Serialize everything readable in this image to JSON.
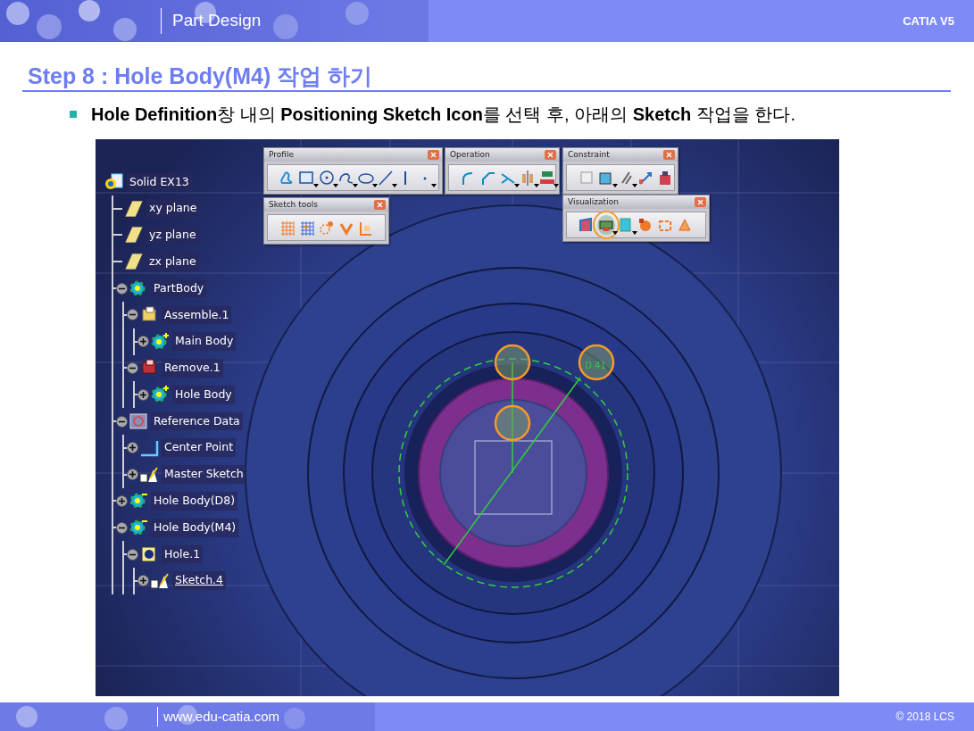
{
  "header": {
    "section": "Part Design",
    "product": "CATIA V5"
  },
  "title": "Step 8 : Hole Body(M4) 작업 하기",
  "instruction": "**Hole Definition**창 내의 **Positioning Sketch Icon**를 선택 후, 아래의 **Sketch** 작업을 한다.",
  "viewport": {
    "tree": [
      {
        "label": "Solid EX13",
        "kind": "part",
        "selected": false,
        "children": [
          {
            "label": "xy plane",
            "kind": "plane",
            "selected": false
          },
          {
            "label": "yz plane",
            "kind": "plane",
            "selected": false
          },
          {
            "label": "zx plane",
            "kind": "plane",
            "selected": false
          },
          {
            "label": "PartBody",
            "kind": "body",
            "selected": false,
            "expanded": true,
            "children": [
              {
                "label": "Assemble.1",
                "kind": "assemble",
                "selected": false,
                "expanded": true,
                "children": [
                  {
                    "label": "Main Body",
                    "kind": "body-plus",
                    "selected": false,
                    "expanded": false
                  }
                ]
              },
              {
                "label": "Remove.1",
                "kind": "remove",
                "selected": false,
                "expanded": true,
                "children": [
                  {
                    "label": "Hole Body",
                    "kind": "body-plus",
                    "selected": false,
                    "expanded": false
                  }
                ]
              }
            ]
          },
          {
            "label": "Reference Data",
            "kind": "reference",
            "selected": false,
            "expanded": true,
            "children": [
              {
                "label": "Center Point",
                "kind": "point",
                "selected": false,
                "expanded": false
              },
              {
                "label": "Master Sketch",
                "kind": "sketch",
                "selected": false,
                "expanded": false
              }
            ]
          },
          {
            "label": "Hole Body(D8)",
            "kind": "body-minus",
            "selected": false,
            "expanded": false
          },
          {
            "label": "Hole Body(M4)",
            "kind": "body-minus",
            "selected": false,
            "expanded": true,
            "children": [
              {
                "label": "Hole.1",
                "kind": "hole",
                "selected": false,
                "expanded": true,
                "children": [
                  {
                    "label": "Sketch.4",
                    "kind": "sketch",
                    "selected": true,
                    "expanded": false
                  }
                ]
              }
            ]
          }
        ]
      }
    ],
    "toolbars": [
      {
        "title": "Profile",
        "tools": [
          {
            "kind": "profile",
            "dropdown": false,
            "highlighted": false
          },
          {
            "kind": "rectangle",
            "dropdown": true,
            "highlighted": false
          },
          {
            "kind": "circle",
            "dropdown": true,
            "highlighted": false
          },
          {
            "kind": "spline",
            "dropdown": true,
            "highlighted": false
          },
          {
            "kind": "ellipse",
            "dropdown": true,
            "highlighted": false
          },
          {
            "kind": "line",
            "dropdown": true,
            "highlighted": false
          },
          {
            "kind": "axis",
            "dropdown": false,
            "highlighted": false
          },
          {
            "kind": "point",
            "dropdown": true,
            "highlighted": false
          }
        ]
      },
      {
        "title": "Operation",
        "tools": [
          {
            "kind": "corner",
            "dropdown": false,
            "highlighted": false
          },
          {
            "kind": "chamfer",
            "dropdown": false,
            "highlighted": false
          },
          {
            "kind": "trim",
            "dropdown": true,
            "highlighted": false
          },
          {
            "kind": "mirror",
            "dropdown": true,
            "highlighted": false
          },
          {
            "kind": "project",
            "dropdown": true,
            "highlighted": false
          }
        ]
      },
      {
        "title": "Constraint",
        "tools": [
          {
            "kind": "constraint-dialog",
            "dropdown": false,
            "highlighted": false
          },
          {
            "kind": "fix",
            "dropdown": true,
            "highlighted": false
          },
          {
            "kind": "contact",
            "dropdown": true,
            "highlighted": false
          },
          {
            "kind": "dimension",
            "dropdown": false,
            "highlighted": false
          },
          {
            "kind": "animate",
            "dropdown": false,
            "highlighted": false
          }
        ]
      },
      {
        "title": "Sketch tools",
        "tools": [
          {
            "kind": "grid",
            "dropdown": false,
            "highlighted": false
          },
          {
            "kind": "snap",
            "dropdown": false,
            "highlighted": false
          },
          {
            "kind": "construction",
            "dropdown": false,
            "highlighted": false
          },
          {
            "kind": "geometric-constraint",
            "dropdown": false,
            "highlighted": false
          },
          {
            "kind": "dimensional-constraint",
            "dropdown": false,
            "highlighted": false
          }
        ]
      },
      {
        "title": "Visualization",
        "tools": [
          {
            "kind": "cut-part",
            "dropdown": false,
            "highlighted": false
          },
          {
            "kind": "sketch-view",
            "dropdown": true,
            "highlighted": true
          },
          {
            "kind": "diagnosis",
            "dropdown": true,
            "highlighted": false
          },
          {
            "kind": "show-3d",
            "dropdown": false,
            "highlighted": false
          },
          {
            "kind": "show-2d",
            "dropdown": false,
            "highlighted": false
          },
          {
            "kind": "show-geometry",
            "dropdown": false,
            "highlighted": false
          }
        ]
      }
    ],
    "dimension_label": "D.41"
  },
  "footer": {
    "url": "www.edu-catia.com",
    "copyright": "© 2018 LCS"
  }
}
